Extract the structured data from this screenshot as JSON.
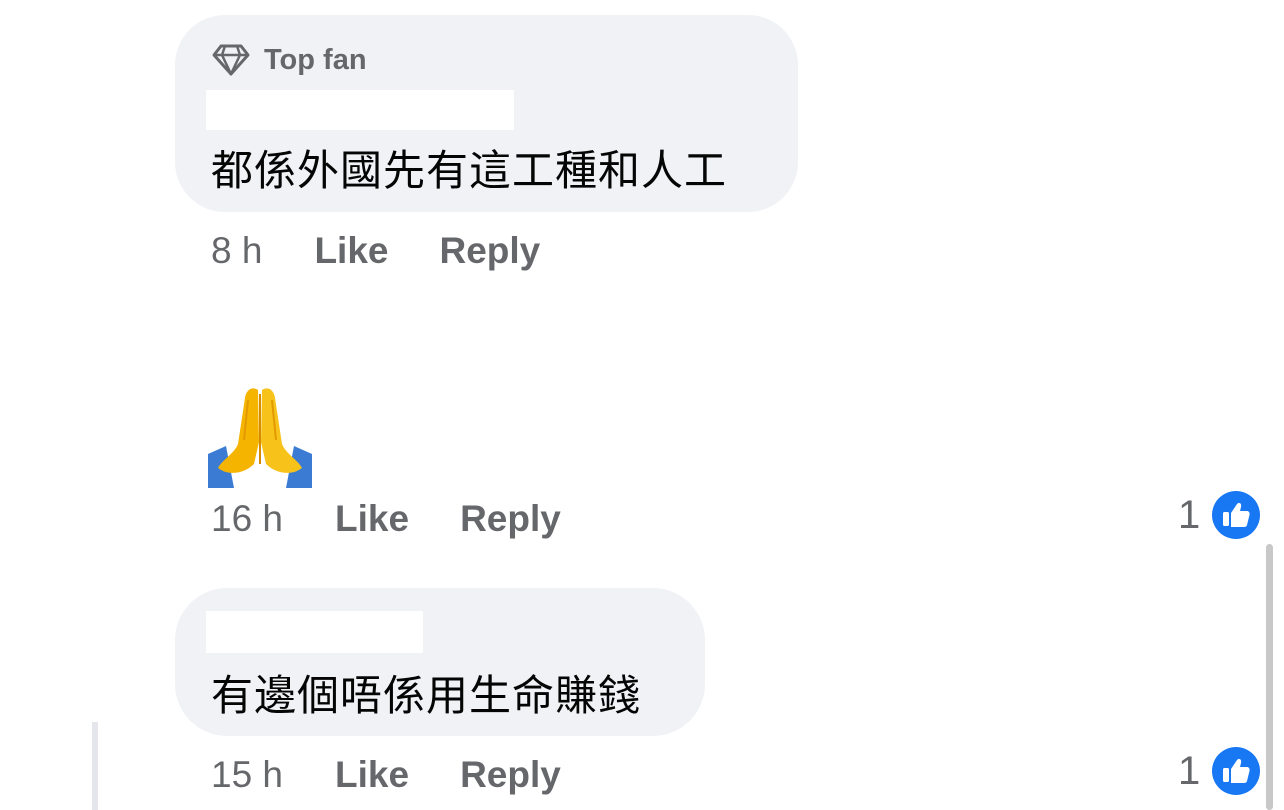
{
  "comments": [
    {
      "badge": "Top fan",
      "badge_icon": "diamond-icon",
      "text": "都係外國先有這工種和人工",
      "time": "8 h",
      "like_label": "Like",
      "reply_label": "Reply"
    },
    {
      "emoji": "folded-hands-emoji",
      "time": "16 h",
      "like_label": "Like",
      "reply_label": "Reply",
      "reaction_count": "1"
    },
    {
      "text": "有邊個唔係用生命賺錢",
      "time": "15 h",
      "like_label": "Like",
      "reply_label": "Reply",
      "reaction_count": "1"
    }
  ],
  "colors": {
    "bubble": "#f0f2f5",
    "meta_text": "#65676b",
    "like_blue": "#1877f2"
  }
}
